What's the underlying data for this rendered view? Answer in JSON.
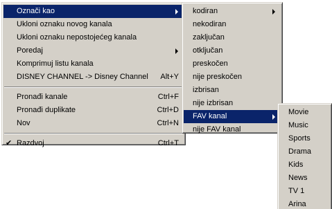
{
  "main_menu": {
    "items": [
      {
        "label": "Označi kao",
        "accel": "",
        "submenu": true,
        "selected": true,
        "checked": false
      },
      {
        "label": "Ukloni oznaku novog kanala",
        "accel": "",
        "submenu": false,
        "selected": false,
        "checked": false
      },
      {
        "label": "Ukloni oznaku nepostojećeg kanala",
        "accel": "",
        "submenu": false,
        "selected": false,
        "checked": false
      },
      {
        "label": "Poredaj",
        "accel": "",
        "submenu": true,
        "selected": false,
        "checked": false
      },
      {
        "label": "Komprimuj listu kanala",
        "accel": "",
        "submenu": false,
        "selected": false,
        "checked": false
      },
      {
        "label": "DISNEY CHANNEL -> Disney Channel",
        "accel": "Alt+Y",
        "submenu": false,
        "selected": false,
        "checked": false
      },
      {
        "label": "Pronađi kanale",
        "accel": "Ctrl+F",
        "submenu": false,
        "selected": false,
        "checked": false
      },
      {
        "label": "Pronađi duplikate",
        "accel": "Ctrl+D",
        "submenu": false,
        "selected": false,
        "checked": false
      },
      {
        "label": "Nov",
        "accel": "Ctrl+N",
        "submenu": false,
        "selected": false,
        "checked": false
      },
      {
        "label": "Razdvoj",
        "accel": "Ctrl+T",
        "submenu": false,
        "selected": false,
        "checked": true
      }
    ],
    "check_glyph": "✔"
  },
  "status_menu": {
    "items": [
      {
        "label": "kodiran",
        "submenu": true,
        "selected": false
      },
      {
        "label": "nekodiran",
        "submenu": false,
        "selected": false
      },
      {
        "label": "zaključan",
        "submenu": false,
        "selected": false
      },
      {
        "label": "otključan",
        "submenu": false,
        "selected": false
      },
      {
        "label": "preskočen",
        "submenu": false,
        "selected": false
      },
      {
        "label": "nije preskočen",
        "submenu": false,
        "selected": false
      },
      {
        "label": "izbrisan",
        "submenu": false,
        "selected": false
      },
      {
        "label": "nije izbrisan",
        "submenu": false,
        "selected": false
      },
      {
        "label": "FAV kanal",
        "submenu": true,
        "selected": true
      },
      {
        "label": "nije FAV kanal",
        "submenu": false,
        "selected": false
      }
    ]
  },
  "fav_menu": {
    "items": [
      "Movie",
      "Music",
      "Sports",
      "Drama",
      "Kids",
      "News",
      "TV 1",
      "Arina"
    ]
  },
  "colors": {
    "menu_bg": "#d4d0c8",
    "highlight": "#0a246a",
    "highlight_text": "#ffffff"
  }
}
